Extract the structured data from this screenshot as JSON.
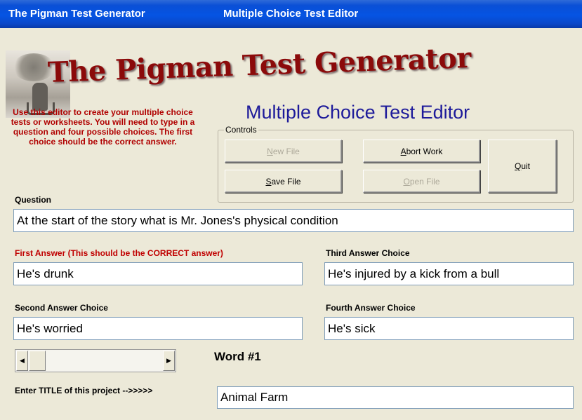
{
  "window": {
    "title_left": "The Pigman Test Generator",
    "title_right": "Multiple Choice Test Editor"
  },
  "header": {
    "app_title": "The Pigman Test Generator",
    "subtitle": "Multiple Choice Test Editor",
    "intro_text": "Use this editor to create your multiple choice tests or worksheets.  You will need to type in a question and four possible choices.  The first choice should be the correct answer."
  },
  "controls": {
    "legend": "Controls",
    "new_file": {
      "label_mnemonic": "N",
      "label_rest": "ew File",
      "enabled": false
    },
    "save_file": {
      "label_mnemonic": "S",
      "label_rest": "ave File",
      "enabled": true
    },
    "abort_work": {
      "label_mnemonic": "A",
      "label_rest": "bort Work",
      "enabled": true
    },
    "open_file": {
      "label_mnemonic": "O",
      "label_rest": "pen File",
      "enabled": false
    },
    "quit": {
      "label_mnemonic": "Q",
      "label_rest": "uit",
      "enabled": true
    }
  },
  "question": {
    "label": "Question",
    "value": "At the start of the story what is Mr. Jones's physical condition"
  },
  "answers": {
    "first": {
      "label": "First Answer (This should be the CORRECT answer)",
      "value": "He's drunk"
    },
    "second": {
      "label": "Second Answer Choice",
      "value": "He's worried"
    },
    "third": {
      "label": "Third Answer Choice",
      "value": "He's injured by a kick from a bull"
    },
    "fourth": {
      "label": "Fourth Answer Choice",
      "value": "He's sick"
    }
  },
  "navigation": {
    "word_label": "Word #1",
    "left_arrow": "◀",
    "right_arrow": "▶"
  },
  "project": {
    "title_label": "Enter TITLE of this project -->>>>>",
    "title_value": "Animal Farm"
  },
  "colors": {
    "titlebar": "#0554e3",
    "app_title": "#8b0a0a",
    "subtitle": "#1d1a9a",
    "intro_text": "#b00000",
    "first_answer_label": "#c00000",
    "window_bg": "#ece9d8"
  }
}
